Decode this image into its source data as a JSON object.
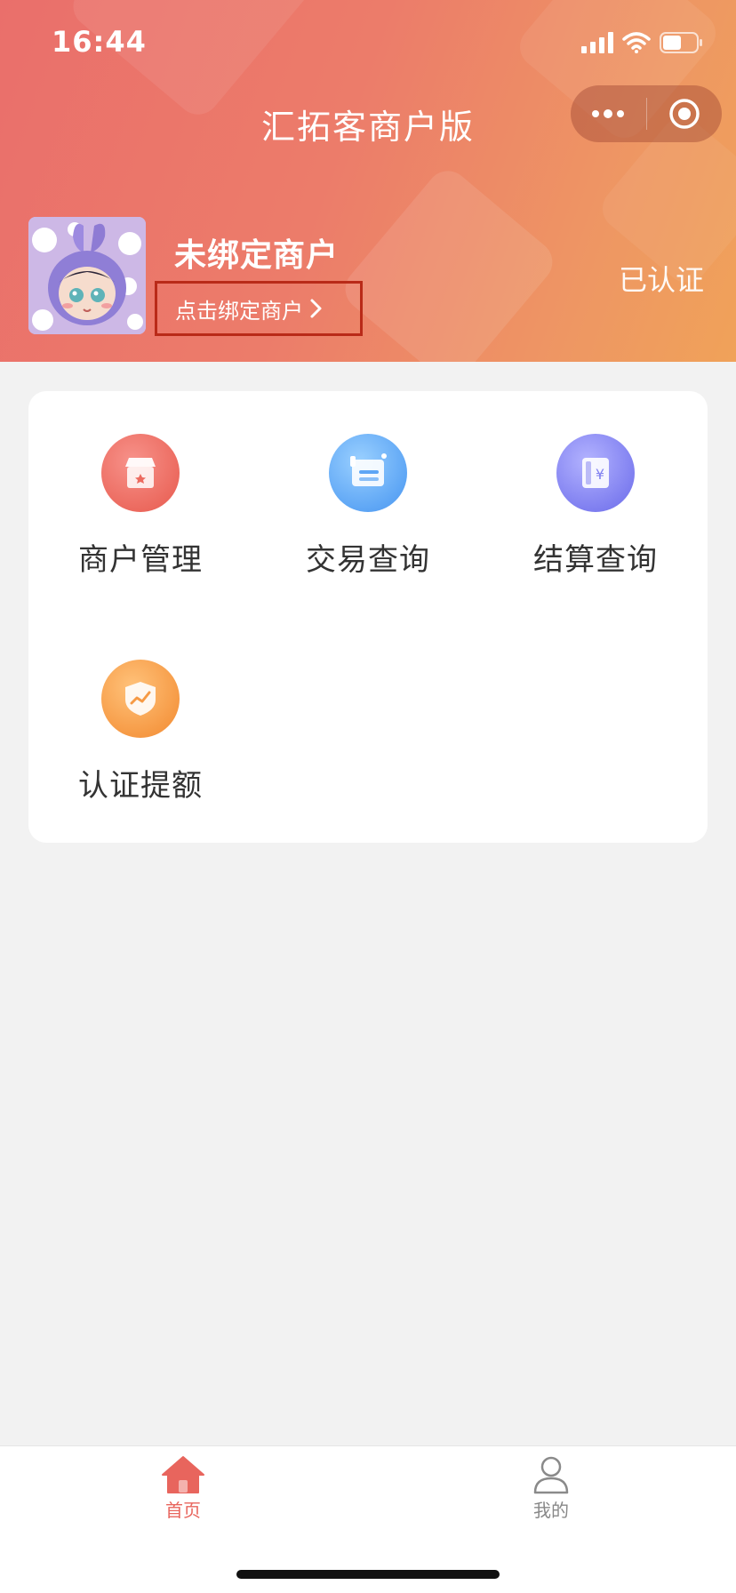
{
  "status_bar": {
    "time": "16:44"
  },
  "nav": {
    "title": "汇拓客商户版"
  },
  "merchant": {
    "name": "未绑定商户",
    "bind_link": "点击绑定商户",
    "status": "已认证"
  },
  "menu": {
    "items": [
      {
        "label": "商户管理",
        "icon": "store-icon",
        "color": "#ec6a5f"
      },
      {
        "label": "交易查询",
        "icon": "card-reader-icon",
        "color": "#5ea6f5"
      },
      {
        "label": "结算查询",
        "icon": "settlement-icon",
        "color": "#7f7ff0"
      },
      {
        "label": "认证提额",
        "icon": "shield-chart-icon",
        "color": "#f69a45"
      }
    ]
  },
  "tabbar": {
    "tabs": [
      {
        "label": "首页",
        "icon": "home-icon",
        "active": true
      },
      {
        "label": "我的",
        "icon": "user-icon",
        "active": false
      }
    ]
  },
  "colors": {
    "accent": "#e8655d",
    "header_start": "#ea6f6b",
    "header_end": "#f0a259"
  }
}
